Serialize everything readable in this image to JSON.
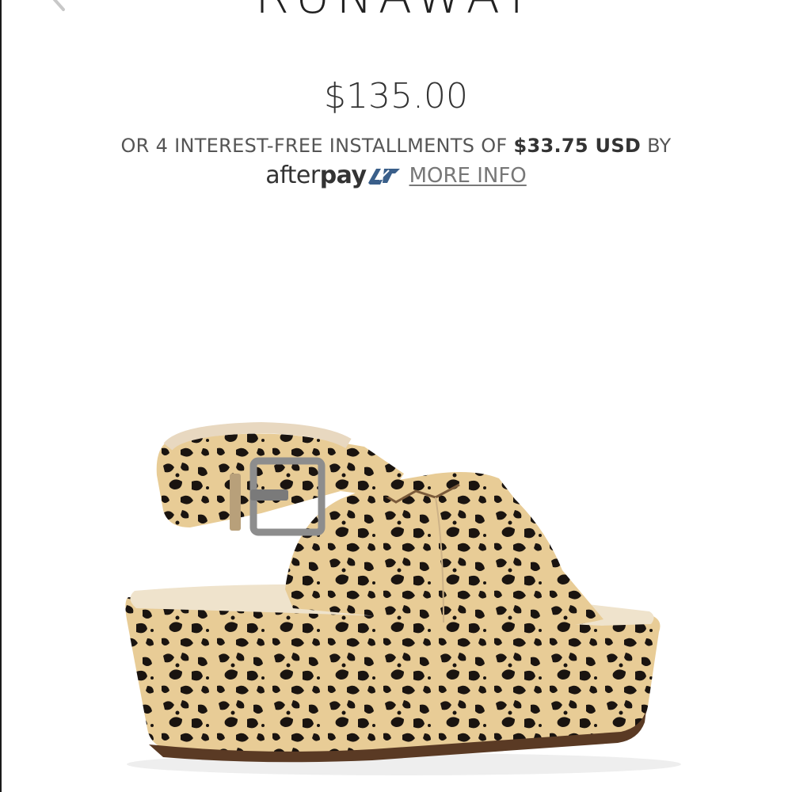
{
  "product": {
    "title": "RUNAWAY",
    "price": "$135.00",
    "image_alt": "Leopard print platform wedge sandal"
  },
  "installments": {
    "prefix": "OR 4 INTEREST-FREE INSTALLMENTS OF",
    "amount": "$33.75 USD",
    "suffix": "BY"
  },
  "afterpay": {
    "logo_text_light": "after",
    "logo_text_bold": "pay",
    "more_info_label": "MORE INFO",
    "brand_color": "#3a5f8a"
  },
  "icons": {
    "back": "chevron-left-icon",
    "afterpay_mark": "afterpay-arrows-icon"
  }
}
